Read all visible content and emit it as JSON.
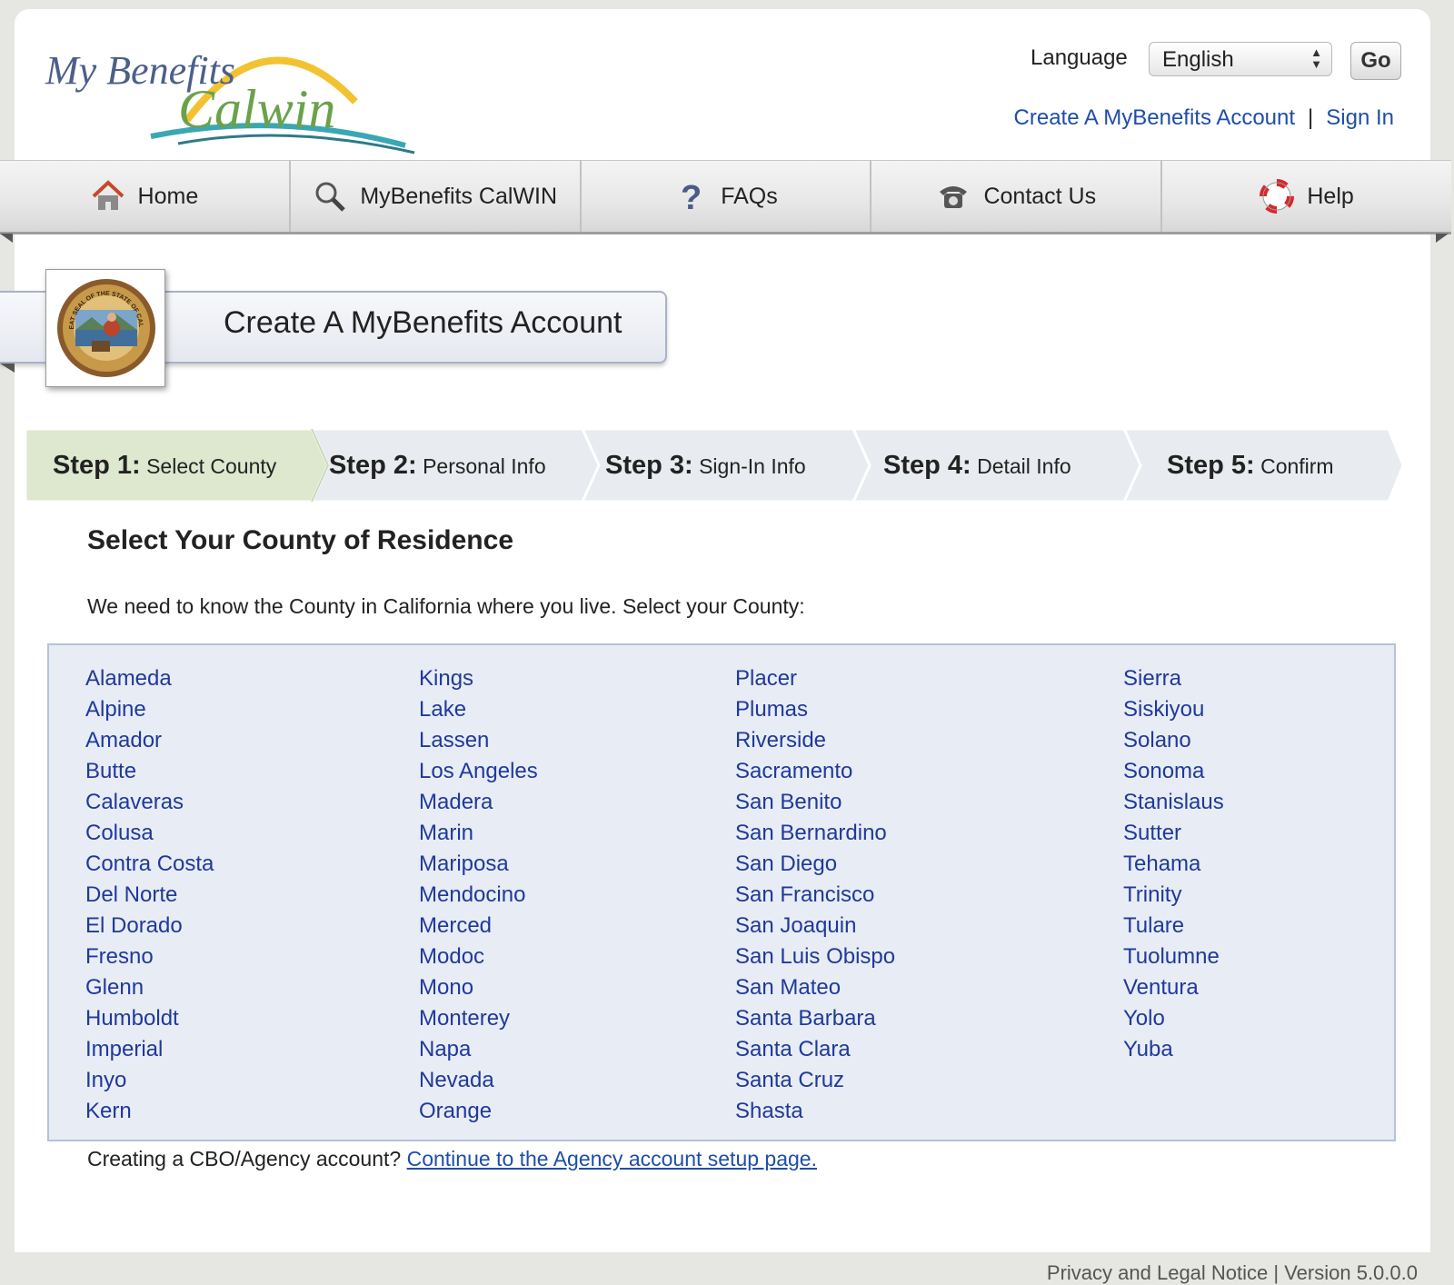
{
  "header": {
    "logo_text_1": "My Benefits",
    "logo_text_2": "CalWIN",
    "language_label": "Language",
    "language_selected": "English",
    "go_label": "Go",
    "create_account_link": "Create A MyBenefits Account",
    "separator": "|",
    "sign_in_link": "Sign In"
  },
  "nav": {
    "items": [
      {
        "label": "Home",
        "icon": "home-icon"
      },
      {
        "label": "MyBenefits CalWIN",
        "icon": "search-icon"
      },
      {
        "label": "FAQs",
        "icon": "question-icon"
      },
      {
        "label": "Contact Us",
        "icon": "phone-icon"
      },
      {
        "label": "Help",
        "icon": "lifebuoy-icon"
      }
    ]
  },
  "banner": {
    "title": "Create A MyBenefits Account",
    "seal_text": "THE GREAT SEAL OF THE STATE OF CALIFORNIA"
  },
  "steps": [
    {
      "number": "Step 1:",
      "label": "Select County",
      "active": true
    },
    {
      "number": "Step 2:",
      "label": "Personal Info",
      "active": false
    },
    {
      "number": "Step 3:",
      "label": "Sign-In Info",
      "active": false
    },
    {
      "number": "Step 4:",
      "label": "Detail Info",
      "active": false
    },
    {
      "number": "Step 5:",
      "label": "Confirm",
      "active": false
    }
  ],
  "main": {
    "section_title": "Select Your County of Residence",
    "intro": "We need to know the County in California where you live. Select your County:",
    "counties": [
      [
        "Alameda",
        "Alpine",
        "Amador",
        "Butte",
        "Calaveras",
        "Colusa",
        "Contra Costa",
        "Del Norte",
        "El Dorado",
        "Fresno",
        "Glenn",
        "Humboldt",
        "Imperial",
        "Inyo",
        "Kern"
      ],
      [
        "Kings",
        "Lake",
        "Lassen",
        "Los Angeles",
        "Madera",
        "Marin",
        "Mariposa",
        "Mendocino",
        "Merced",
        "Modoc",
        "Mono",
        "Monterey",
        "Napa",
        "Nevada",
        "Orange"
      ],
      [
        "Placer",
        "Plumas",
        "Riverside",
        "Sacramento",
        "San Benito",
        "San Bernardino",
        "San Diego",
        "San Francisco",
        "San Joaquin",
        "San Luis Obispo",
        "San Mateo",
        "Santa Barbara",
        "Santa Clara",
        "Santa Cruz",
        "Shasta"
      ],
      [
        "Sierra",
        "Siskiyou",
        "Solano",
        "Sonoma",
        "Stanislaus",
        "Sutter",
        "Tehama",
        "Trinity",
        "Tulare",
        "Tuolumne",
        "Ventura",
        "Yolo",
        "Yuba"
      ]
    ],
    "agency_prompt": "Creating a CBO/Agency account?",
    "agency_link": "Continue to the Agency account setup page."
  },
  "footer": {
    "text": "Privacy and Legal Notice  |  Version 5.0.0.0"
  },
  "colors": {
    "link": "#1f4ea7",
    "county_link": "#1f3a9a",
    "active_step": "#dde8cf",
    "inactive_step": "#e8ebef",
    "county_box": "#e8ecf5"
  }
}
